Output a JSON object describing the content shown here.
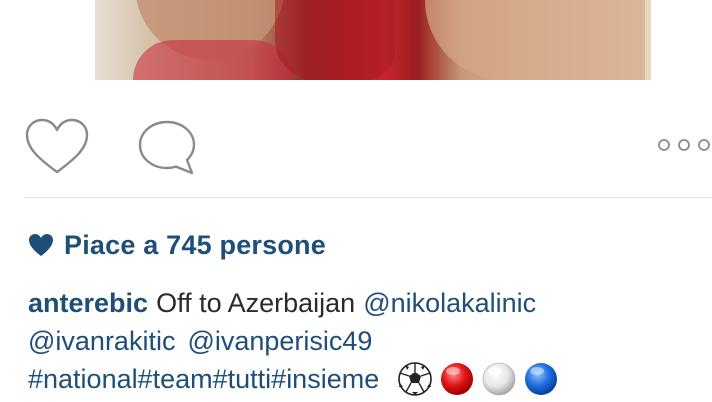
{
  "post": {
    "likes_text": "Piace a 745 persone",
    "caption": {
      "username": "anterebic",
      "text": "Off to Azerbaijan",
      "line1_mention": "@nikolakalinic",
      "line2_mentions": [
        "@ivanrakitic",
        "@ivanperisic49"
      ],
      "hashtags": "#national#team#tutti#insieme",
      "emoji_names": [
        "soccer-ball",
        "red-circle",
        "white-circle",
        "blue-circle"
      ]
    }
  },
  "colors": {
    "link": "#1f4e79",
    "text": "#2b2b2b",
    "icon_outline": "#8a8a8a",
    "divider": "#e4e4e4"
  },
  "icons": [
    "heart-outline-icon",
    "comment-bubble-icon",
    "more-options-icon",
    "heart-filled-icon"
  ]
}
